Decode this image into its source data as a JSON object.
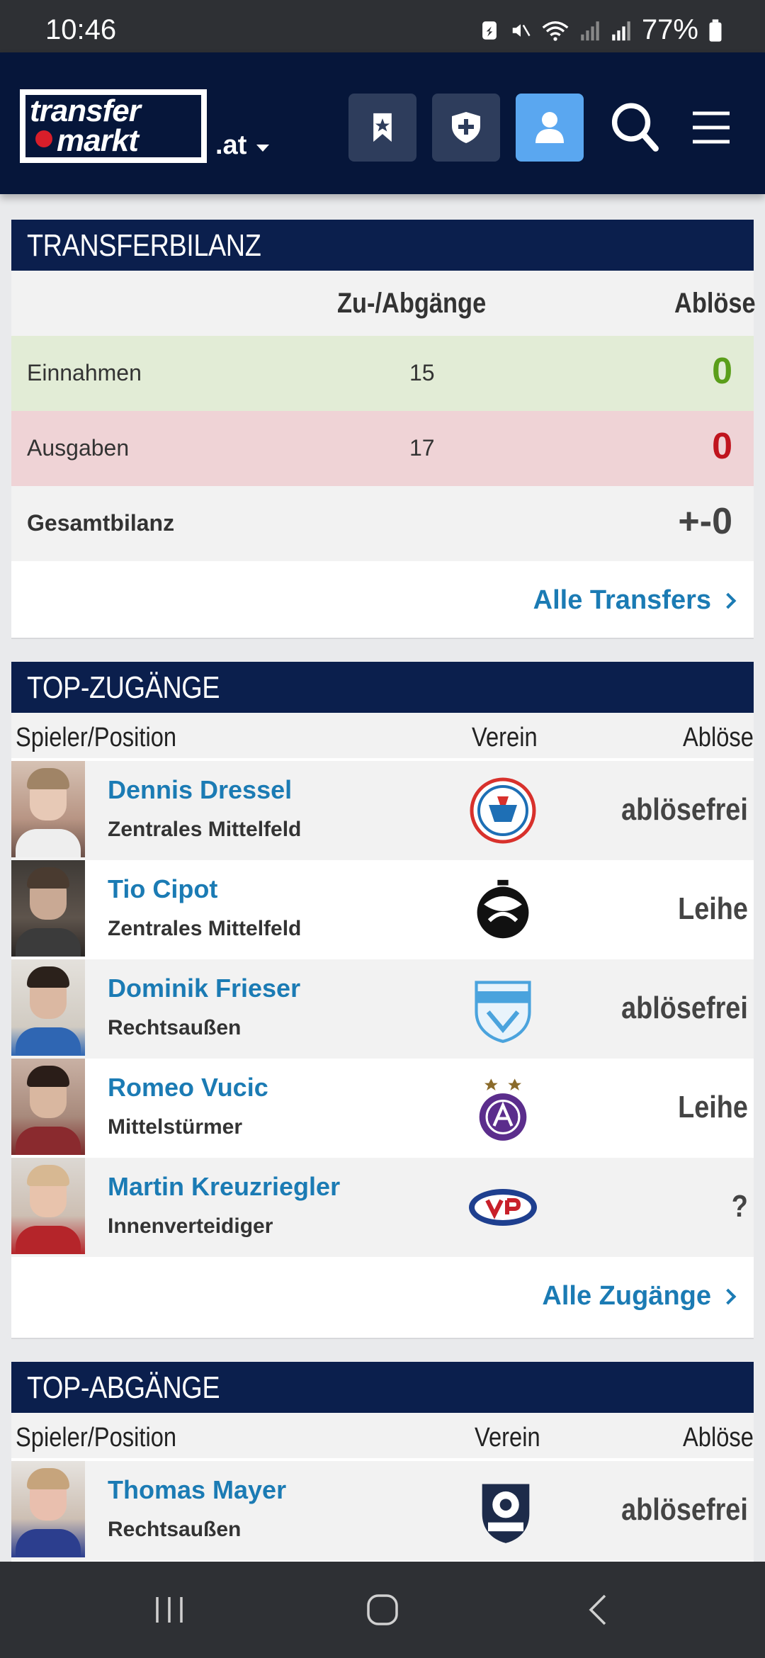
{
  "status": {
    "time": "10:46",
    "battery": "77%"
  },
  "header": {
    "logo_line1": "transfer",
    "logo_line2": "markt",
    "domain": ".at",
    "icons": [
      "bookmark-icon",
      "shield-plus-icon",
      "user-icon",
      "search-icon",
      "menu-icon"
    ]
  },
  "bilanz": {
    "title": "TRANSFERBILANZ",
    "col_moves": "Zu-/Abgänge",
    "col_fee": "Ablöse",
    "rows": [
      {
        "label": "Einnahmen",
        "count": "15",
        "fee": "0",
        "color": "#5a9e1a",
        "bg": "#e2ecd6"
      },
      {
        "label": "Ausgaben",
        "count": "17",
        "fee": "0",
        "color": "#c0141e",
        "bg": "#efd3d6"
      },
      {
        "label": "Gesamtbilanz",
        "count": "",
        "fee": "+-0",
        "color": "#444444",
        "bg": "#f2f2f2"
      }
    ],
    "all_link": "Alle Transfers"
  },
  "zugaenge": {
    "title": "TOP-ZUGÄNGE",
    "col_player": "Spieler/Position",
    "col_club": "Verein",
    "col_fee": "Ablöse",
    "players": [
      {
        "name": "Dennis Dressel",
        "position": "Zentrales Mittelfeld",
        "fee": "ablösefrei"
      },
      {
        "name": "Tio Cipot",
        "position": "Zentrales Mittelfeld",
        "fee": "Leihe"
      },
      {
        "name": "Dominik Frieser",
        "position": "Rechtsaußen",
        "fee": "ablösefrei"
      },
      {
        "name": "Romeo Vucic",
        "position": "Mittelstürmer",
        "fee": "Leihe"
      },
      {
        "name": "Martin Kreuzriegler",
        "position": "Innenverteidiger",
        "fee": "?"
      }
    ],
    "all_link": "Alle Zugänge"
  },
  "abgaenge": {
    "title": "TOP-ABGÄNGE",
    "col_player": "Spieler/Position",
    "col_club": "Verein",
    "col_fee": "Ablöse",
    "players": [
      {
        "name": "Thomas Mayer",
        "position": "Rechtsaußen",
        "fee": "ablösefrei"
      }
    ]
  }
}
